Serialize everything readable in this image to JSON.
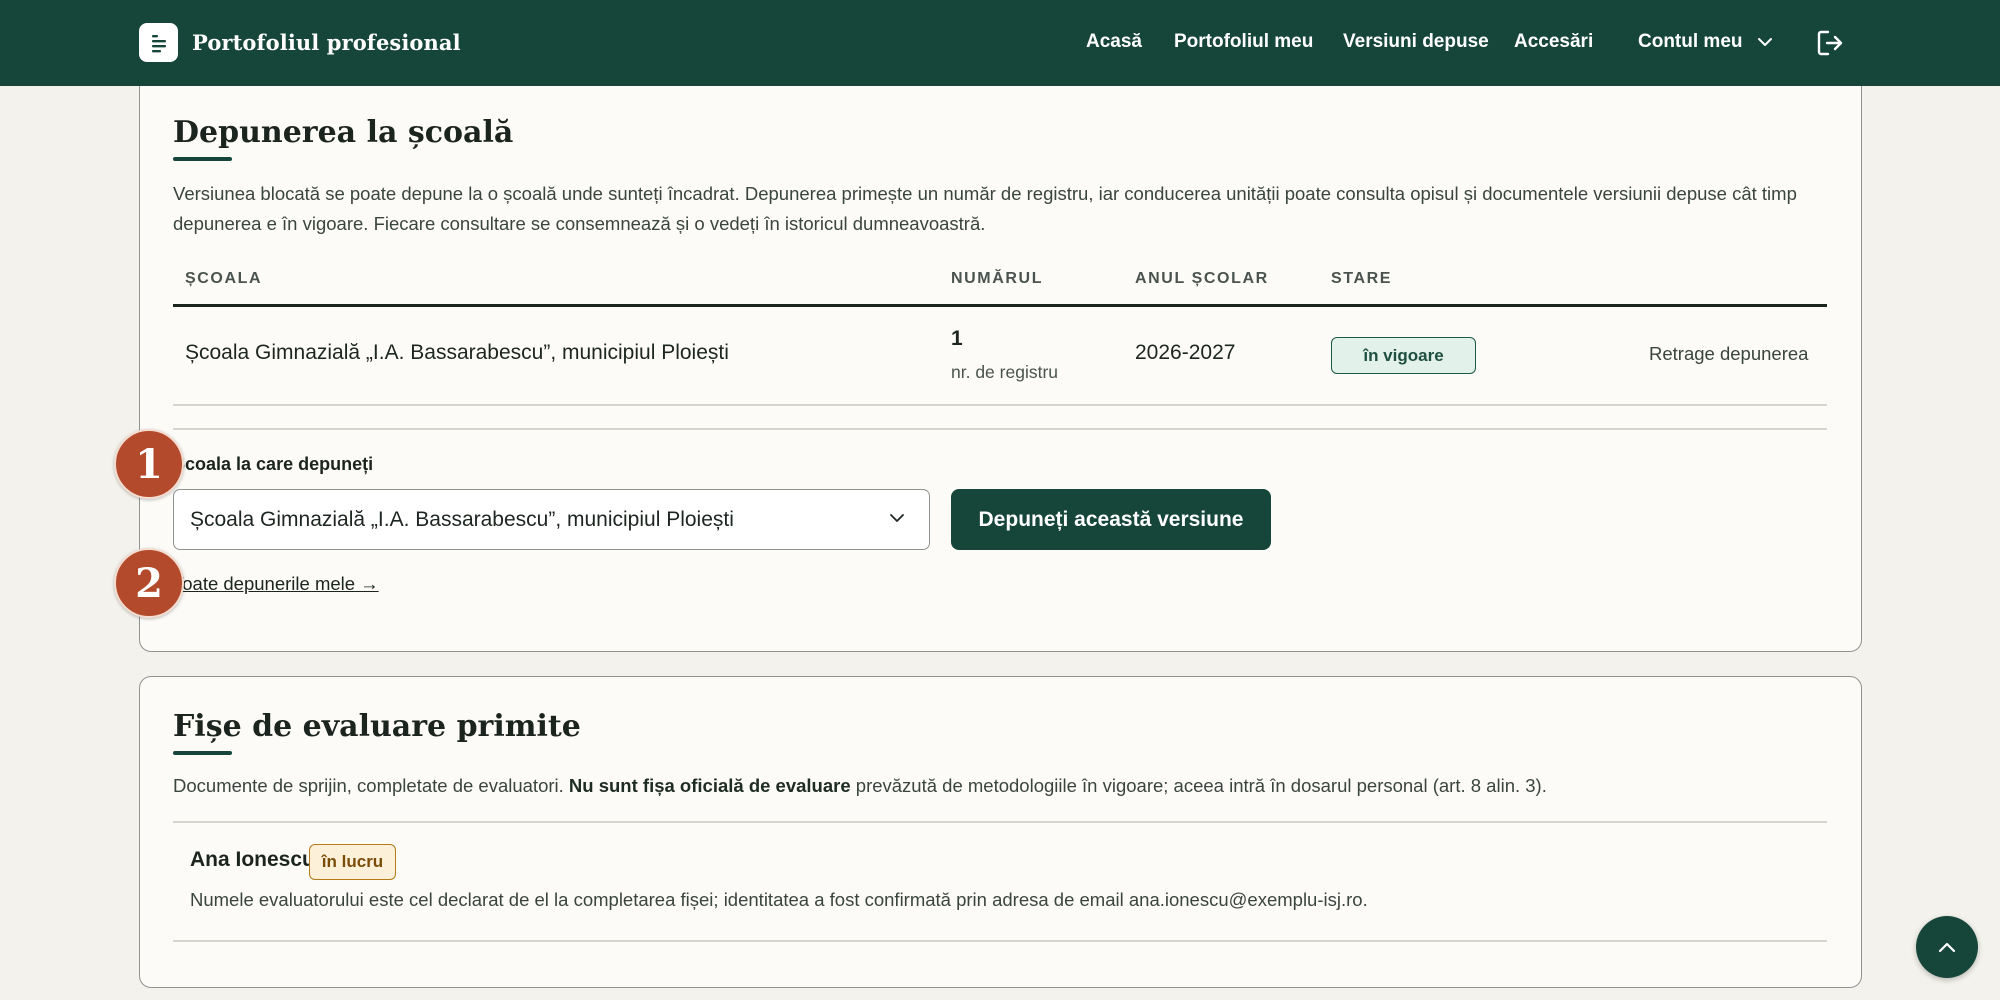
{
  "header": {
    "brand": "Portofoliul profesional",
    "nav": [
      "Acasă",
      "Portofoliul meu",
      "Versiuni depuse",
      "Accesări"
    ],
    "account": "Contul meu"
  },
  "submission": {
    "title": "Depunerea la școală",
    "description_line1": "Versiunea blocată se poate depune la o școală unde sunteți încadrat. Depunerea primește un număr de registru, iar conducerea unității poate consulta opisul și documentele versiunii depuse cât timp",
    "description_line2": "depunerea e în vigoare. Fiecare consultare se consemnează și o vedeți în istoricul dumneavoastră.",
    "columns": [
      "ȘCOALA",
      "NUMĂRUL",
      "ANUL ȘCOLAR",
      "STARE"
    ],
    "rows": [
      {
        "school": "Școala Gimnazială „I.A. Bassarabescu”, municipiul Ploiești",
        "number": "1",
        "number_caption": "nr. de registru",
        "year": "2026-2027",
        "status": "în vigoare",
        "action": "Retrage depunerea"
      }
    ],
    "field_label": "Școala la care depuneți",
    "selected_school": "Școala Gimnazială „I.A. Bassarabescu”, municipiul Ploiești",
    "submit_label": "Depuneți această versiune",
    "all_link": "Toate depunerile mele →"
  },
  "markers": [
    "1",
    "2"
  ],
  "evaluations": {
    "title": "Fișe de evaluare primite",
    "desc_before": "Documente de sprijin, completate de evaluatori. ",
    "desc_bold": "Nu sunt fișa oficială de evaluare",
    "desc_after": " prevăzută de metodologiile în vigoare; aceea intră în dosarul personal (art. 8 alin. 3).",
    "items": [
      {
        "name": "Ana Ionescu",
        "status": "în lucru",
        "note": "Numele evaluatorului este cel declarat de el la completarea fișei; identitatea a fost confirmată prin adresa de email ana.ionescu@exemplu-isj.ro."
      }
    ]
  },
  "colors": {
    "primary": "#16463a",
    "marker": "#b34a2b",
    "badge_ok_bg": "#e2f1ea",
    "badge_work_bg": "#fdf0d8"
  },
  "icons": [
    "document-icon",
    "chevron-down-icon",
    "logout-icon",
    "arrow-up-icon"
  ]
}
